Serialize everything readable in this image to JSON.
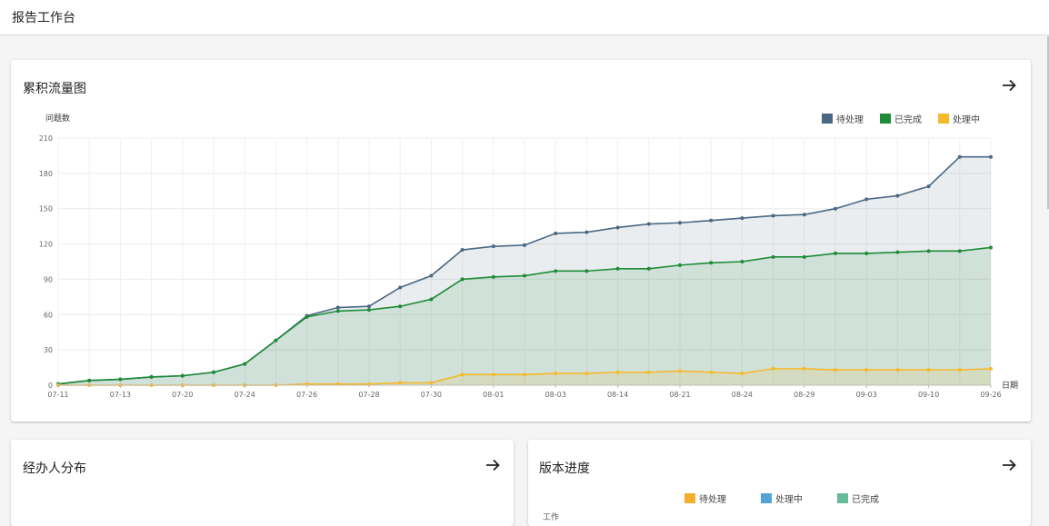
{
  "page": {
    "title": "报告工作台"
  },
  "cfd": {
    "title": "累积流量图",
    "legend": [
      {
        "name": "待处理",
        "color": "#4a6784"
      },
      {
        "name": "已完成",
        "color": "#1e8c36"
      },
      {
        "name": "处理中",
        "color": "#f5b92b"
      }
    ]
  },
  "chart_data": {
    "type": "area",
    "ylabel": "问题数",
    "xlabel": "日期",
    "ylim": [
      0,
      210
    ],
    "yticks": [
      0,
      30,
      60,
      90,
      120,
      150,
      180,
      210
    ],
    "grid": true,
    "legend_position": "top-right",
    "x": [
      "07-11",
      "07-12",
      "07-13",
      "07-14",
      "07-20",
      "07-23",
      "07-24",
      "07-25",
      "07-26",
      "07-27",
      "07-28",
      "07-29",
      "07-30",
      "07-31",
      "08-01",
      "08-02",
      "08-03",
      "08-04",
      "08-14",
      "08-20",
      "08-21",
      "08-22",
      "08-24",
      "08-25",
      "08-29",
      "08-30",
      "09-03",
      "09-04",
      "09-10",
      "09-11",
      "09-26"
    ],
    "x_tick_labels": [
      "07-11",
      "07-13",
      "07-20",
      "07-24",
      "07-26",
      "07-28",
      "07-30",
      "08-01",
      "08-03",
      "08-14",
      "08-21",
      "08-24",
      "08-29",
      "09-03",
      "09-10",
      "09-26"
    ],
    "series": [
      {
        "name": "待处理",
        "color": "#4a6784",
        "values": [
          1,
          4,
          5,
          7,
          8,
          11,
          18,
          38,
          59,
          66,
          67,
          83,
          93,
          115,
          118,
          119,
          129,
          130,
          134,
          137,
          138,
          140,
          142,
          144,
          145,
          150,
          158,
          161,
          169,
          194,
          194
        ]
      },
      {
        "name": "已完成",
        "color": "#1e8c36",
        "values": [
          1,
          4,
          5,
          7,
          8,
          11,
          18,
          38,
          58,
          63,
          64,
          67,
          73,
          90,
          92,
          93,
          97,
          97,
          99,
          99,
          102,
          104,
          105,
          109,
          109,
          112,
          112,
          113,
          114,
          114,
          117
        ]
      },
      {
        "name": "处理中",
        "color": "#f5b92b",
        "values": [
          0,
          0,
          0,
          0,
          0,
          0,
          0,
          0,
          1,
          1,
          1,
          2,
          2,
          9,
          9,
          9,
          10,
          10,
          11,
          11,
          12,
          11,
          10,
          14,
          14,
          13,
          13,
          13,
          13,
          13,
          14
        ]
      }
    ]
  },
  "assignee": {
    "title": "经办人分布"
  },
  "version": {
    "title": "版本进度",
    "legend": [
      {
        "name": "待处理",
        "color": "#f2ae2c"
      },
      {
        "name": "处理中",
        "color": "#54a2d9"
      },
      {
        "name": "已完成",
        "color": "#67bb98"
      }
    ],
    "cut_label": "工作"
  }
}
